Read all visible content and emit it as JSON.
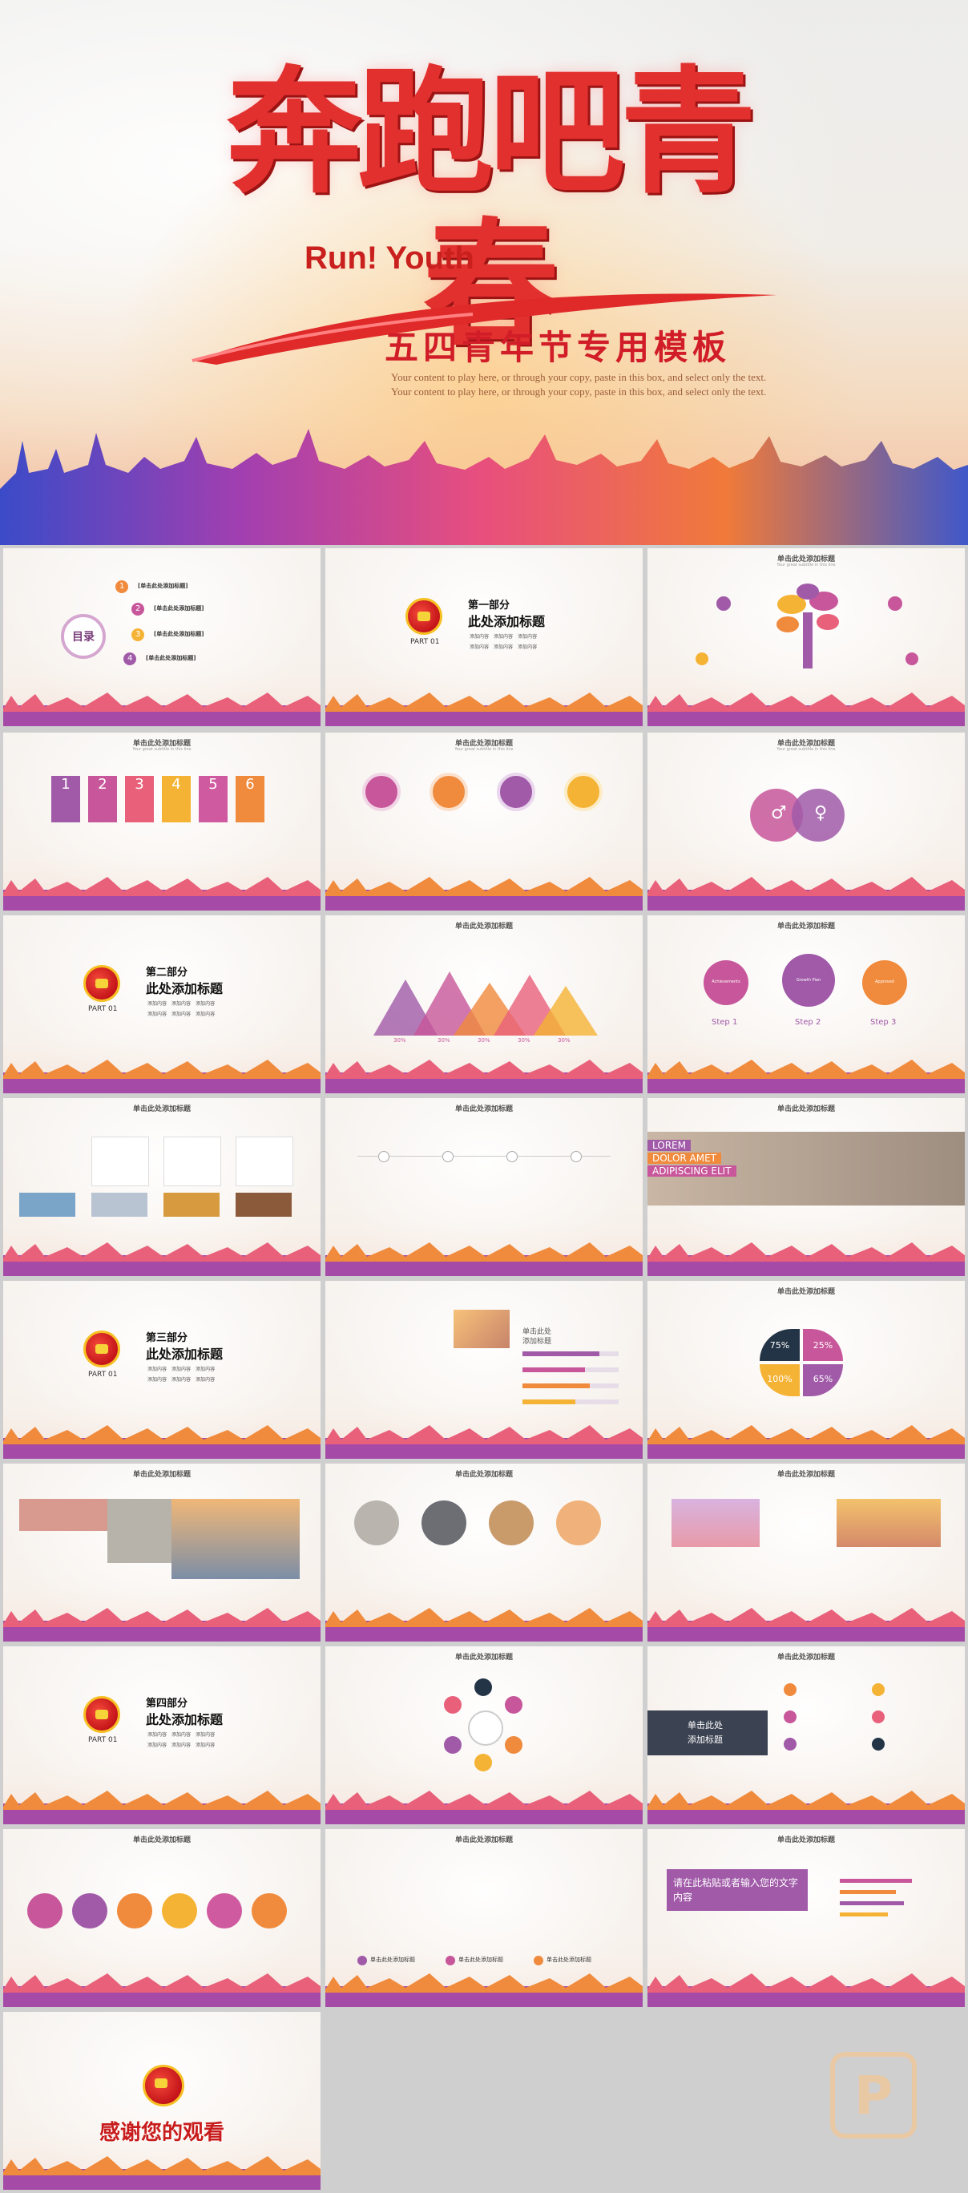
{
  "hero": {
    "title": "奔跑吧青春",
    "subtitle_en": "Run! Youth",
    "tagline": "五四青年节专用模板",
    "description": "Your content to play here, or through your copy, paste in this box, and select only the text. Your content to play here, or through your copy, paste in this box, and select only the text."
  },
  "slides": {
    "toc": {
      "label": "目录",
      "items": [
        "[单击此处添加标题]",
        "[单击此处添加标题]",
        "[单击此处添加标题]",
        "[单击此处添加标题]"
      ],
      "numbers": [
        "1",
        "2",
        "3",
        "4"
      ]
    },
    "section_title": "单击此处添加标题",
    "section_subtitle": "Your great subtitle in this line",
    "parts": [
      {
        "part": "第一部分",
        "title": "此处添加标题",
        "label": "PART 01"
      },
      {
        "part": "第二部分",
        "title": "此处添加标题",
        "label": "PART 01"
      },
      {
        "part": "第三部分",
        "title": "此处添加标题",
        "label": "PART 01"
      },
      {
        "part": "第四部分",
        "title": "此处添加标题",
        "label": "PART 01"
      }
    ],
    "bullet": "添加内容",
    "numbered_tabs": [
      "1",
      "2",
      "3",
      "4",
      "5",
      "6"
    ],
    "steps": [
      "Step 1",
      "Step 2",
      "Step 3"
    ],
    "step_circles": [
      "Achievements",
      "Growth Plan",
      "Approved"
    ],
    "peaks_percents": [
      "30%",
      "30%",
      "30%",
      "30%",
      "30%"
    ],
    "lorem_banner": [
      "LOREM",
      "DOLOR AMET",
      "ADIPISCING ELIT"
    ],
    "quarter_percents": [
      "75%",
      "25%",
      "100%",
      "65%"
    ],
    "column_label": "单击此处添加标题",
    "add_title_short": [
      "单击此处",
      "添加标题"
    ],
    "paste_text": "请在此粘贴或者输入您的文字内容",
    "thanks": "感谢您的观看"
  },
  "watermark": "P",
  "colors": {
    "red": "#e2302f",
    "purple": "#a05aa8",
    "magenta": "#c7569a",
    "orange": "#f08a3c",
    "yellow": "#f5b335"
  }
}
